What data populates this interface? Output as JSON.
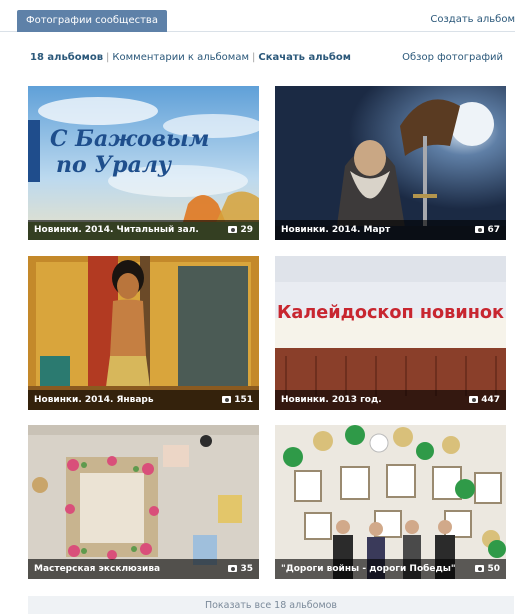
{
  "header": {
    "active_tab": "Фотографии сообщества",
    "create_link": "Создать альбом"
  },
  "summary": {
    "albums_count": "18 альбомов",
    "comments_link": "Комментарии к альбомам",
    "download_link": "Скачать альбом",
    "overview_link": "Обзор фотографий"
  },
  "albums": [
    {
      "title": "Новинки. 2014. Читальный зал.",
      "count": "29",
      "banner_line1": "С Бажовым",
      "banner_line2": "по Уралу"
    },
    {
      "title": "Новинки. 2014. Март",
      "count": "67"
    },
    {
      "title": "Новинки. 2014. Январь",
      "count": "151"
    },
    {
      "title": "Новинки. 2013 год.",
      "count": "447",
      "banner_text": "Калейдоскоп новинок"
    },
    {
      "title": "Мастерская эксклюзива",
      "count": "35"
    },
    {
      "title": "\"Дороги войны - дороги Победы\"",
      "count": "50"
    }
  ],
  "footer": {
    "show_all": "Показать все 18 альбомов"
  },
  "colors": {
    "tab_bg": "#5e81a8",
    "link": "#2b587a",
    "caption_bg": "rgba(0,0,0,0.62)"
  },
  "icons": {
    "count_icon": "camera-icon"
  }
}
